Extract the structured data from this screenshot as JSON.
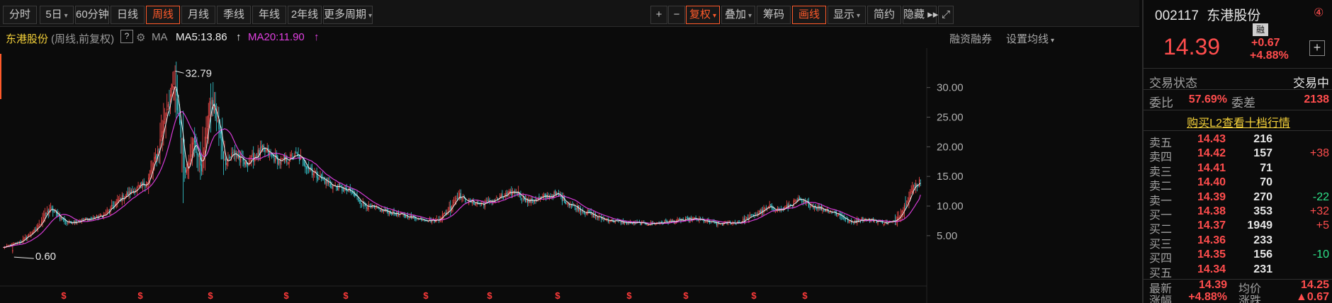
{
  "toolbar": {
    "periods": [
      {
        "label": "分时",
        "active": false,
        "dropdown": false
      },
      {
        "label": "5日",
        "active": false,
        "dropdown": true
      },
      {
        "label": "60分钟",
        "active": false,
        "dropdown": false
      },
      {
        "label": "日线",
        "active": false,
        "dropdown": false
      },
      {
        "label": "周线",
        "active": true,
        "dropdown": false
      },
      {
        "label": "月线",
        "active": false,
        "dropdown": false
      },
      {
        "label": "季线",
        "active": false,
        "dropdown": false
      },
      {
        "label": "年线",
        "active": false,
        "dropdown": false
      },
      {
        "label": "2年线",
        "active": false,
        "dropdown": false
      },
      {
        "label": "更多周期",
        "active": false,
        "dropdown": true
      }
    ],
    "tools": [
      {
        "label": "+",
        "active": false,
        "dropdown": false
      },
      {
        "label": "−",
        "active": false,
        "dropdown": false
      },
      {
        "label": "复权",
        "active": true,
        "dropdown": true
      },
      {
        "label": "叠加",
        "active": false,
        "dropdown": true
      },
      {
        "label": "筹码",
        "active": false,
        "dropdown": false
      },
      {
        "label": "画线",
        "active": true,
        "dropdown": false
      },
      {
        "label": "显示",
        "active": false,
        "dropdown": true
      },
      {
        "label": "简约",
        "active": false,
        "dropdown": false
      },
      {
        "label": "隐藏 ▸▸",
        "active": false,
        "dropdown": false
      },
      {
        "label": "⤢",
        "active": false,
        "dropdown": false
      }
    ]
  },
  "chart_header": {
    "stock_name": "东港股份",
    "mode": "(周线,前复权)",
    "help": "?",
    "ma_label": "MA",
    "ma5": "MA5:13.86",
    "ma20": "MA20:11.90",
    "margin_link": "融资融券",
    "ma_settings": "设置均线"
  },
  "colors": {
    "up": "#ff4d4d",
    "down": "#39d0d8",
    "ma5": "#f0f0f0",
    "ma20": "#d63bd6",
    "accent": "#ff5a2a"
  },
  "chart_data": {
    "type": "candlestick",
    "y_ticks": [
      "30.00",
      "25.00",
      "20.00",
      "15.00",
      "10.00",
      "5.00"
    ],
    "ylim": [
      2.0,
      34.5
    ],
    "max_label": "32.79",
    "min_label": "0.60",
    "grid": false,
    "dividend_marker": "$",
    "dividend_count": 12,
    "anchors": [
      [
        0,
        3.0
      ],
      [
        15,
        4.0
      ],
      [
        28,
        6.0
      ],
      [
        40,
        9.6
      ],
      [
        55,
        7.2
      ],
      [
        75,
        7.8
      ],
      [
        88,
        8.5
      ],
      [
        100,
        11.0
      ],
      [
        112,
        12.5
      ],
      [
        125,
        14.0
      ],
      [
        135,
        20.0
      ],
      [
        142,
        27.0
      ],
      [
        148,
        30.5
      ],
      [
        153,
        24.0
      ],
      [
        158,
        15.5
      ],
      [
        165,
        21.0
      ],
      [
        172,
        16.5
      ],
      [
        180,
        28.0
      ],
      [
        186,
        24.0
      ],
      [
        192,
        17.5
      ],
      [
        200,
        19.0
      ],
      [
        210,
        17.0
      ],
      [
        225,
        19.5
      ],
      [
        240,
        17.5
      ],
      [
        255,
        18.5
      ],
      [
        270,
        15.5
      ],
      [
        285,
        13.5
      ],
      [
        300,
        12.5
      ],
      [
        315,
        10.0
      ],
      [
        330,
        9.2
      ],
      [
        345,
        8.5
      ],
      [
        360,
        7.9
      ],
      [
        375,
        7.5
      ],
      [
        385,
        9.0
      ],
      [
        395,
        12.0
      ],
      [
        400,
        11.0
      ],
      [
        415,
        10.3
      ],
      [
        430,
        11.3
      ],
      [
        445,
        12.5
      ],
      [
        455,
        10.8
      ],
      [
        470,
        11.5
      ],
      [
        480,
        12.0
      ],
      [
        490,
        10.5
      ],
      [
        505,
        9.0
      ],
      [
        520,
        7.8
      ],
      [
        540,
        7.2
      ],
      [
        560,
        7.0
      ],
      [
        580,
        7.4
      ],
      [
        600,
        7.8
      ],
      [
        620,
        7.0
      ],
      [
        640,
        7.3
      ],
      [
        655,
        8.8
      ],
      [
        665,
        9.8
      ],
      [
        675,
        9.3
      ],
      [
        690,
        11.0
      ],
      [
        700,
        10.2
      ],
      [
        715,
        9.3
      ],
      [
        725,
        8.6
      ],
      [
        735,
        7.2
      ],
      [
        745,
        7.8
      ],
      [
        755,
        7.6
      ],
      [
        765,
        7.2
      ],
      [
        773,
        7.3
      ],
      [
        781,
        9.5
      ],
      [
        787,
        12.3
      ],
      [
        792,
        13.6
      ],
      [
        796,
        14.4
      ]
    ],
    "n_weeks": 797,
    "ma5_last": 13.86,
    "ma20_last": 11.9
  },
  "quote": {
    "code": "002117",
    "name": "东港股份",
    "badge": "④",
    "rong": "融",
    "price": "14.39",
    "change": "+0.67",
    "change_pct": "+4.88%",
    "add_btn": "+",
    "status_label": "交易状态",
    "status_value": "交易中",
    "weibi_label": "委比",
    "weibi_value": "57.69%",
    "weicha_label": "委差",
    "weicha_value": "2138",
    "l2_link": "购买L2查看十档行情",
    "sells": [
      {
        "label": "卖五",
        "price": "14.43",
        "vol": "216",
        "chg": ""
      },
      {
        "label": "卖四",
        "price": "14.42",
        "vol": "157",
        "chg": "+38"
      },
      {
        "label": "卖三",
        "price": "14.41",
        "vol": "71",
        "chg": ""
      },
      {
        "label": "卖二",
        "price": "14.40",
        "vol": "70",
        "chg": ""
      },
      {
        "label": "卖一",
        "price": "14.39",
        "vol": "270",
        "chg": "-22"
      }
    ],
    "buys": [
      {
        "label": "买一",
        "price": "14.38",
        "vol": "353",
        "chg": "+32"
      },
      {
        "label": "买二",
        "price": "14.37",
        "vol": "1949",
        "chg": "+5"
      },
      {
        "label": "买三",
        "price": "14.36",
        "vol": "233",
        "chg": ""
      },
      {
        "label": "买四",
        "price": "14.35",
        "vol": "156",
        "chg": "-10"
      },
      {
        "label": "买五",
        "price": "14.34",
        "vol": "231",
        "chg": ""
      }
    ],
    "latest_label": "最新",
    "latest_value": "14.39",
    "avg_label": "均价",
    "avg_value": "14.25",
    "chgpct_label": "涨幅",
    "chgpct_value": "+4.88%",
    "chg_label": "涨跌",
    "chg_value": "▲0.67"
  }
}
